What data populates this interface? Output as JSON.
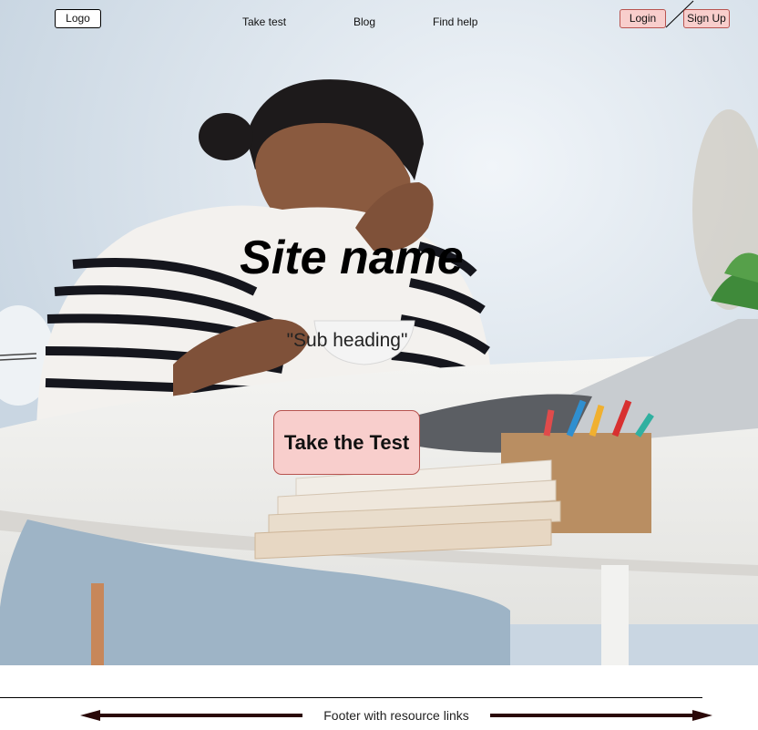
{
  "nav": {
    "logo_label": "Logo",
    "links": [
      "Take test",
      "Blog",
      "Find help"
    ],
    "login_label": "Login",
    "signup_label": "Sign Up"
  },
  "hero": {
    "site_name": "Site name",
    "sub_heading": "\"Sub heading\"",
    "cta_label": "Take the Test"
  },
  "footer": {
    "text": "Footer with resource links"
  },
  "colors": {
    "button_fill": "#f8cecc",
    "button_border": "#b85450",
    "arrow": "#2a0808"
  }
}
